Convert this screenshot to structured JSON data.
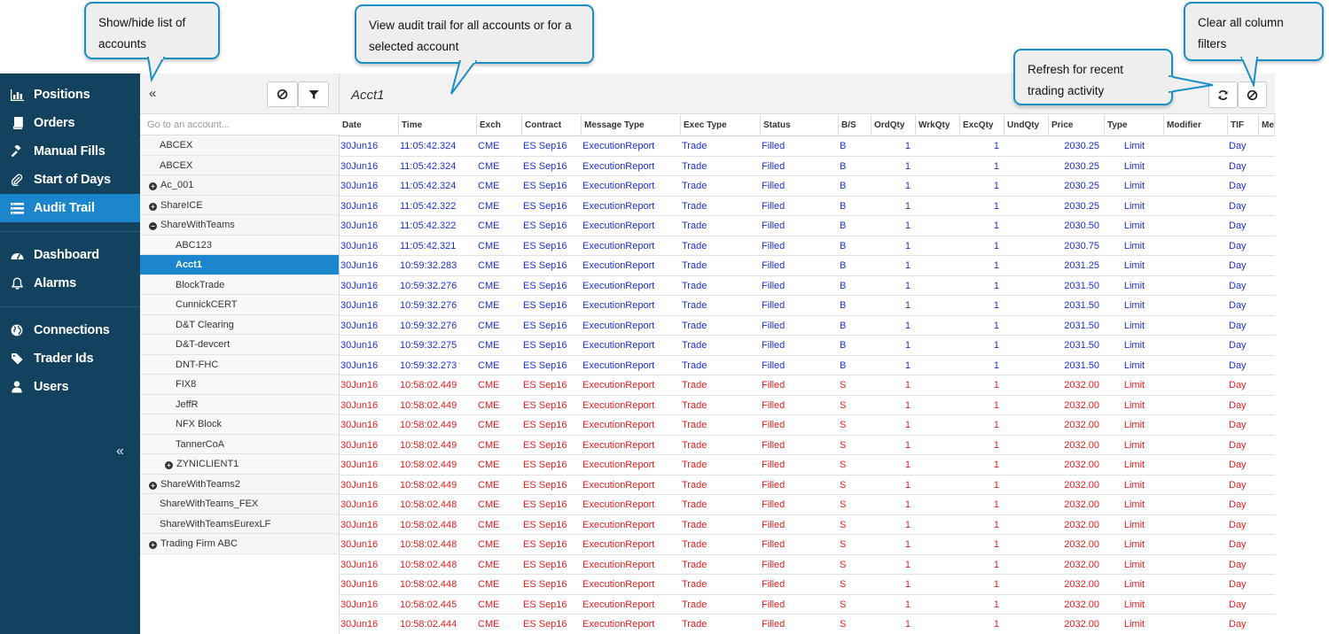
{
  "colors": {
    "sidebar_bg": "#13425e",
    "active": "#1b86cc",
    "buy_text": "#1d2fd0",
    "sell_text": "#e21e1e",
    "callout_border": "#1a8fc6"
  },
  "callouts": {
    "show_hide": "Show/hide list of accounts",
    "view_audit": "View audit trail for all accounts or for a selected account",
    "refresh": "Refresh for recent trading activity",
    "clear_filters": "Clear all column filters"
  },
  "nav": {
    "groups": [
      [
        {
          "label": "Positions",
          "icon": "bar-chart-icon"
        },
        {
          "label": "Orders",
          "icon": "book-icon"
        },
        {
          "label": "Manual Fills",
          "icon": "gavel-icon"
        },
        {
          "label": "Start of Days",
          "icon": "paperclip-icon"
        },
        {
          "label": "Audit Trail",
          "icon": "list-icon",
          "active": true
        }
      ],
      [
        {
          "label": "Dashboard",
          "icon": "dashboard-icon"
        },
        {
          "label": "Alarms",
          "icon": "bell-icon"
        }
      ],
      [
        {
          "label": "Connections",
          "icon": "globe-icon"
        },
        {
          "label": "Trader Ids",
          "icon": "tag-icon"
        },
        {
          "label": "Users",
          "icon": "user-icon"
        }
      ]
    ],
    "collapse_glyph": "«"
  },
  "accounts": {
    "collapse_glyph": "«",
    "search_placeholder": "Go to an account...",
    "items": [
      {
        "label": "ABCEX",
        "indent": 1,
        "expander": ""
      },
      {
        "label": "ABCEX",
        "indent": 1,
        "expander": ""
      },
      {
        "label": "Ac_001",
        "indent": 0,
        "expander": "+"
      },
      {
        "label": "ShareICE",
        "indent": 0,
        "expander": "+"
      },
      {
        "label": "ShareWithTeams",
        "indent": 0,
        "expander": "−"
      },
      {
        "label": "ABC123",
        "indent": 2,
        "expander": ""
      },
      {
        "label": "Acct1",
        "indent": 2,
        "expander": "",
        "selected": true
      },
      {
        "label": "BlockTrade",
        "indent": 2,
        "expander": ""
      },
      {
        "label": "CunnickCERT",
        "indent": 2,
        "expander": ""
      },
      {
        "label": "D&T Clearing",
        "indent": 2,
        "expander": ""
      },
      {
        "label": "D&T-devcert",
        "indent": 2,
        "expander": ""
      },
      {
        "label": "DNT-FHC",
        "indent": 2,
        "expander": ""
      },
      {
        "label": "FIX8",
        "indent": 2,
        "expander": ""
      },
      {
        "label": "JeffR",
        "indent": 2,
        "expander": ""
      },
      {
        "label": "NFX Block",
        "indent": 2,
        "expander": ""
      },
      {
        "label": "TannerCoA",
        "indent": 2,
        "expander": ""
      },
      {
        "label": "ZYNICLIENT1",
        "indent": 3,
        "expander": "+"
      },
      {
        "label": "ShareWithTeams2",
        "indent": 0,
        "expander": "+"
      },
      {
        "label": "ShareWithTeams_FEX",
        "indent": 1,
        "expander": ""
      },
      {
        "label": "ShareWithTeamsEurexLF",
        "indent": 1,
        "expander": ""
      },
      {
        "label": "Trading Firm ABC",
        "indent": 0,
        "expander": "+"
      }
    ]
  },
  "main": {
    "title": "Acct1",
    "columns": [
      "Date",
      "Time",
      "Exch",
      "Contract",
      "Message Type",
      "Exec Type",
      "Status",
      "B/S",
      "OrdQty",
      "WrkQty",
      "ExcQty",
      "UndQty",
      "Price",
      "Type",
      "Modifier",
      "TIF",
      "Me"
    ],
    "rows": [
      [
        "30Jun16",
        "11:05:42.324",
        "CME",
        "ES Sep16",
        "ExecutionReport",
        "Trade",
        "Filled",
        "B",
        "1",
        "",
        "1",
        "",
        "2030.25",
        "Limit",
        "",
        "Day"
      ],
      [
        "30Jun16",
        "11:05:42.324",
        "CME",
        "ES Sep16",
        "ExecutionReport",
        "Trade",
        "Filled",
        "B",
        "1",
        "",
        "1",
        "",
        "2030.25",
        "Limit",
        "",
        "Day"
      ],
      [
        "30Jun16",
        "11:05:42.324",
        "CME",
        "ES Sep16",
        "ExecutionReport",
        "Trade",
        "Filled",
        "B",
        "1",
        "",
        "1",
        "",
        "2030.25",
        "Limit",
        "",
        "Day"
      ],
      [
        "30Jun16",
        "11:05:42.322",
        "CME",
        "ES Sep16",
        "ExecutionReport",
        "Trade",
        "Filled",
        "B",
        "1",
        "",
        "1",
        "",
        "2030.25",
        "Limit",
        "",
        "Day"
      ],
      [
        "30Jun16",
        "11:05:42.322",
        "CME",
        "ES Sep16",
        "ExecutionReport",
        "Trade",
        "Filled",
        "B",
        "1",
        "",
        "1",
        "",
        "2030.50",
        "Limit",
        "",
        "Day"
      ],
      [
        "30Jun16",
        "11:05:42.321",
        "CME",
        "ES Sep16",
        "ExecutionReport",
        "Trade",
        "Filled",
        "B",
        "1",
        "",
        "1",
        "",
        "2030.75",
        "Limit",
        "",
        "Day"
      ],
      [
        "30Jun16",
        "10:59:32.283",
        "CME",
        "ES Sep16",
        "ExecutionReport",
        "Trade",
        "Filled",
        "B",
        "1",
        "",
        "1",
        "",
        "2031.25",
        "Limit",
        "",
        "Day"
      ],
      [
        "30Jun16",
        "10:59:32.276",
        "CME",
        "ES Sep16",
        "ExecutionReport",
        "Trade",
        "Filled",
        "B",
        "1",
        "",
        "1",
        "",
        "2031.50",
        "Limit",
        "",
        "Day"
      ],
      [
        "30Jun16",
        "10:59:32.276",
        "CME",
        "ES Sep16",
        "ExecutionReport",
        "Trade",
        "Filled",
        "B",
        "1",
        "",
        "1",
        "",
        "2031.50",
        "Limit",
        "",
        "Day"
      ],
      [
        "30Jun16",
        "10:59:32.276",
        "CME",
        "ES Sep16",
        "ExecutionReport",
        "Trade",
        "Filled",
        "B",
        "1",
        "",
        "1",
        "",
        "2031.50",
        "Limit",
        "",
        "Day"
      ],
      [
        "30Jun16",
        "10:59:32.275",
        "CME",
        "ES Sep16",
        "ExecutionReport",
        "Trade",
        "Filled",
        "B",
        "1",
        "",
        "1",
        "",
        "2031.50",
        "Limit",
        "",
        "Day"
      ],
      [
        "30Jun16",
        "10:59:32.273",
        "CME",
        "ES Sep16",
        "ExecutionReport",
        "Trade",
        "Filled",
        "B",
        "1",
        "",
        "1",
        "",
        "2031.50",
        "Limit",
        "",
        "Day"
      ],
      [
        "30Jun16",
        "10:58:02.449",
        "CME",
        "ES Sep16",
        "ExecutionReport",
        "Trade",
        "Filled",
        "S",
        "1",
        "",
        "1",
        "",
        "2032.00",
        "Limit",
        "",
        "Day"
      ],
      [
        "30Jun16",
        "10:58:02.449",
        "CME",
        "ES Sep16",
        "ExecutionReport",
        "Trade",
        "Filled",
        "S",
        "1",
        "",
        "1",
        "",
        "2032.00",
        "Limit",
        "",
        "Day"
      ],
      [
        "30Jun16",
        "10:58:02.449",
        "CME",
        "ES Sep16",
        "ExecutionReport",
        "Trade",
        "Filled",
        "S",
        "1",
        "",
        "1",
        "",
        "2032.00",
        "Limit",
        "",
        "Day"
      ],
      [
        "30Jun16",
        "10:58:02.449",
        "CME",
        "ES Sep16",
        "ExecutionReport",
        "Trade",
        "Filled",
        "S",
        "1",
        "",
        "1",
        "",
        "2032.00",
        "Limit",
        "",
        "Day"
      ],
      [
        "30Jun16",
        "10:58:02.449",
        "CME",
        "ES Sep16",
        "ExecutionReport",
        "Trade",
        "Filled",
        "S",
        "1",
        "",
        "1",
        "",
        "2032.00",
        "Limit",
        "",
        "Day"
      ],
      [
        "30Jun16",
        "10:58:02.449",
        "CME",
        "ES Sep16",
        "ExecutionReport",
        "Trade",
        "Filled",
        "S",
        "1",
        "",
        "1",
        "",
        "2032.00",
        "Limit",
        "",
        "Day"
      ],
      [
        "30Jun16",
        "10:58:02.448",
        "CME",
        "ES Sep16",
        "ExecutionReport",
        "Trade",
        "Filled",
        "S",
        "1",
        "",
        "1",
        "",
        "2032.00",
        "Limit",
        "",
        "Day"
      ],
      [
        "30Jun16",
        "10:58:02.448",
        "CME",
        "ES Sep16",
        "ExecutionReport",
        "Trade",
        "Filled",
        "S",
        "1",
        "",
        "1",
        "",
        "2032.00",
        "Limit",
        "",
        "Day"
      ],
      [
        "30Jun16",
        "10:58:02.448",
        "CME",
        "ES Sep16",
        "ExecutionReport",
        "Trade",
        "Filled",
        "S",
        "1",
        "",
        "1",
        "",
        "2032.00",
        "Limit",
        "",
        "Day"
      ],
      [
        "30Jun16",
        "10:58:02.448",
        "CME",
        "ES Sep16",
        "ExecutionReport",
        "Trade",
        "Filled",
        "S",
        "1",
        "",
        "1",
        "",
        "2032.00",
        "Limit",
        "",
        "Day"
      ],
      [
        "30Jun16",
        "10:58:02.448",
        "CME",
        "ES Sep16",
        "ExecutionReport",
        "Trade",
        "Filled",
        "S",
        "1",
        "",
        "1",
        "",
        "2032.00",
        "Limit",
        "",
        "Day"
      ],
      [
        "30Jun16",
        "10:58:02.445",
        "CME",
        "ES Sep16",
        "ExecutionReport",
        "Trade",
        "Filled",
        "S",
        "1",
        "",
        "1",
        "",
        "2032.00",
        "Limit",
        "",
        "Day"
      ],
      [
        "30Jun16",
        "10:58:02.444",
        "CME",
        "ES Sep16",
        "ExecutionReport",
        "Trade",
        "Filled",
        "S",
        "1",
        "",
        "1",
        "",
        "2032.00",
        "Limit",
        "",
        "Day"
      ]
    ]
  }
}
